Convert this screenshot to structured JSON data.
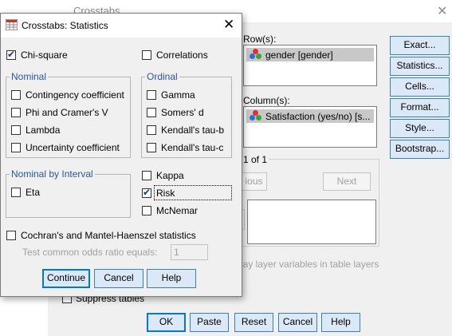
{
  "bg_window": {
    "title": "Crosstabs",
    "close_symbol": "✕",
    "row_label": "Row(s):",
    "row_item": "gender [gender]",
    "column_label": "Column(s):",
    "column_item": "Satisfaction (yes/no) [s...",
    "layer_text": "1 of 1",
    "prev_partial": "ious",
    "next": "Next",
    "display_layer_partial": "lay layer variables in table layers",
    "suppress_tables": "Suppress tables",
    "right_buttons": [
      "Exact...",
      "Statistics...",
      "Cells...",
      "Format...",
      "Style...",
      "Bootstrap..."
    ],
    "bottom_buttons": [
      "OK",
      "Paste",
      "Reset",
      "Cancel",
      "Help"
    ]
  },
  "dialog": {
    "title": "Crosstabs: Statistics",
    "close_symbol": "✕",
    "chi_square": {
      "label": "Chi-square",
      "checked": true
    },
    "correlations": {
      "label": "Correlations",
      "checked": false
    },
    "nominal": {
      "title": "Nominal",
      "items": [
        "Contingency coefficient",
        "Phi and Cramer's V",
        "Lambda",
        "Uncertainty coefficient"
      ]
    },
    "ordinal": {
      "title": "Ordinal",
      "items": [
        "Gamma",
        "Somers' d",
        "Kendall's tau-b",
        "Kendall's tau-c"
      ]
    },
    "nominal_interval": {
      "title": "Nominal by Interval",
      "items": [
        "Eta"
      ]
    },
    "kappa": {
      "label": "Kappa",
      "checked": false
    },
    "risk": {
      "label": "Risk",
      "checked": true
    },
    "mcnemar": {
      "label": "McNemar",
      "checked": false
    },
    "cmh": {
      "label": "Cochran's and Mantel-Haenszel statistics",
      "checked": false
    },
    "odds_label": "Test common odds ratio equals:",
    "odds_value": "1",
    "buttons": [
      "Continue",
      "Cancel",
      "Help"
    ]
  }
}
